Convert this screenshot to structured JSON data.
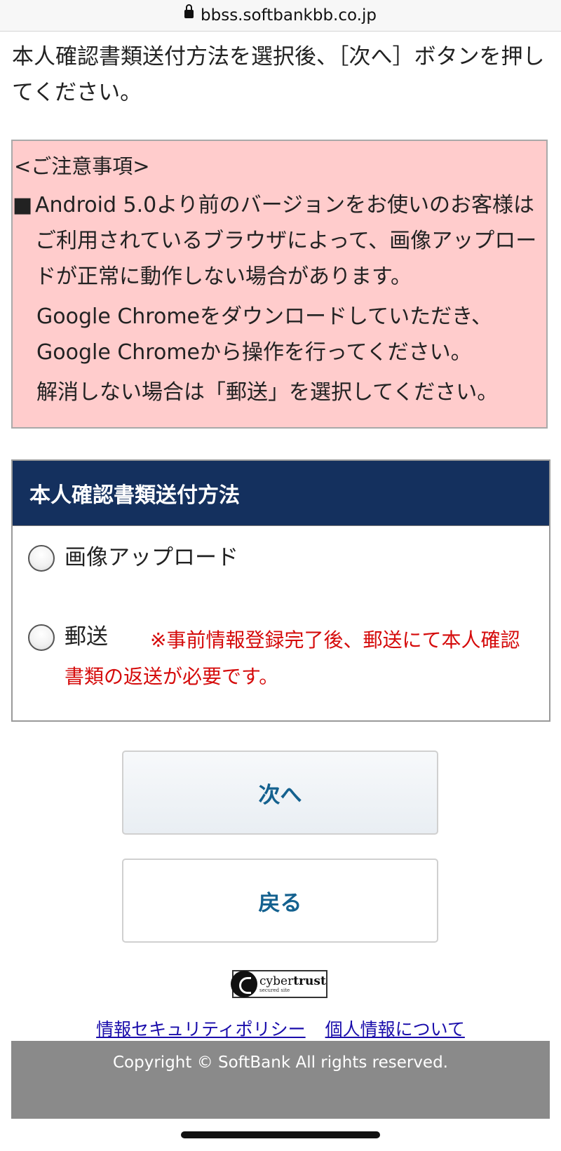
{
  "browser": {
    "url": "bbss.softbankbb.co.jp"
  },
  "intro_text": "本人確認書類送付方法を選択後、［次へ］ボタンを押してください。",
  "notice": {
    "title": "<ご注意事項>",
    "bullet_mark": "■",
    "bullet_text": "Android 5.0より前のバージョンをお使いのお客様はご利用されているブラウザによって、画像アップロードが正常に動作しない場合があります。",
    "line2": "Google Chromeをダウンロードしていただき、Google Chromeから操作を行ってください。",
    "line3": "解消しない場合は「郵送」を選択してください。"
  },
  "method_section": {
    "header": "本人確認書類送付方法",
    "option_upload": "画像アップロード",
    "option_mail": "郵送",
    "mail_note": "※事前情報登録完了後、郵送にて本人確認書類の返送が必要です。"
  },
  "buttons": {
    "next": "次へ",
    "back": "戻る"
  },
  "badge": {
    "brand_light": "cyber",
    "brand_bold": "trust",
    "sub": "secured site"
  },
  "links": {
    "security_policy": "情報セキュリティポリシー",
    "privacy": "個人情報について"
  },
  "footer": {
    "copyright": "Copyright © SoftBank All rights reserved."
  },
  "colors": {
    "header_bg": "#14305e",
    "notice_bg": "#ffcccc",
    "note_red": "#d50b0b",
    "button_text": "#14618f",
    "footer_bg": "#8a8a8a"
  }
}
